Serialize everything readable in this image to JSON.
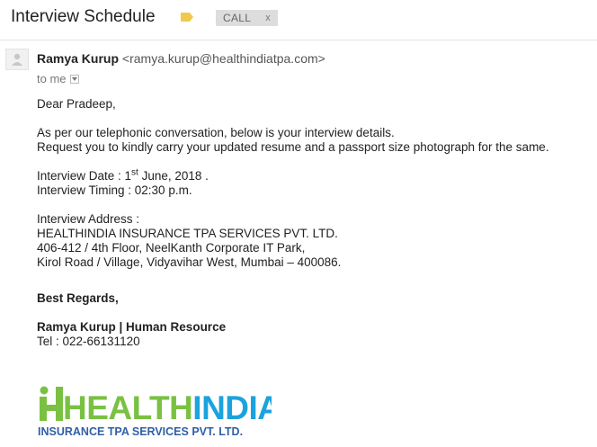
{
  "header": {
    "subject": "Interview Schedule",
    "label_icon": "label-tag-icon",
    "label_color": "#f2c94c",
    "label_chip": "CALL",
    "label_chip_close": "x"
  },
  "message": {
    "avatar_icon": "person-avatar-icon",
    "sender_name": "Ramya Kurup",
    "sender_email": "<ramya.kurup@healthindiatpa.com>",
    "to_label": "to me",
    "greeting": "Dear Pradeep,",
    "para1_line1": "As per our telephonic conversation, below is your interview details.",
    "para1_line2": "Request you to kindly carry your updated resume and a passport size photograph for the same.",
    "date_prefix": "Interview Date : 1",
    "date_sup": "st",
    "date_suffix": " June, 2018 .",
    "timing": "Interview Timing :  02:30 p.m.",
    "address_label": "Interview Address :",
    "address_line1": "HEALTHINDIA INSURANCE TPA SERVICES PVT. LTD.",
    "address_line2": "406-412 / 4th Floor, NeelKanth Corporate IT Park,",
    "address_line3": "Kirol Road / Village, Vidyavihar West, Mumbai – 400086.",
    "regards": "Best Regards,",
    "signature": "Ramya Kurup | Human Resource",
    "tel": "Tel : 022-66131120"
  },
  "logo": {
    "word_green": "HEALTH",
    "word_blue": "INDIA",
    "tagline": "INSURANCE TPA SERVICES PVT. LTD.",
    "green": "#7ac143",
    "blue": "#1aa3dd",
    "tagline_color": "#2f5fa6"
  }
}
